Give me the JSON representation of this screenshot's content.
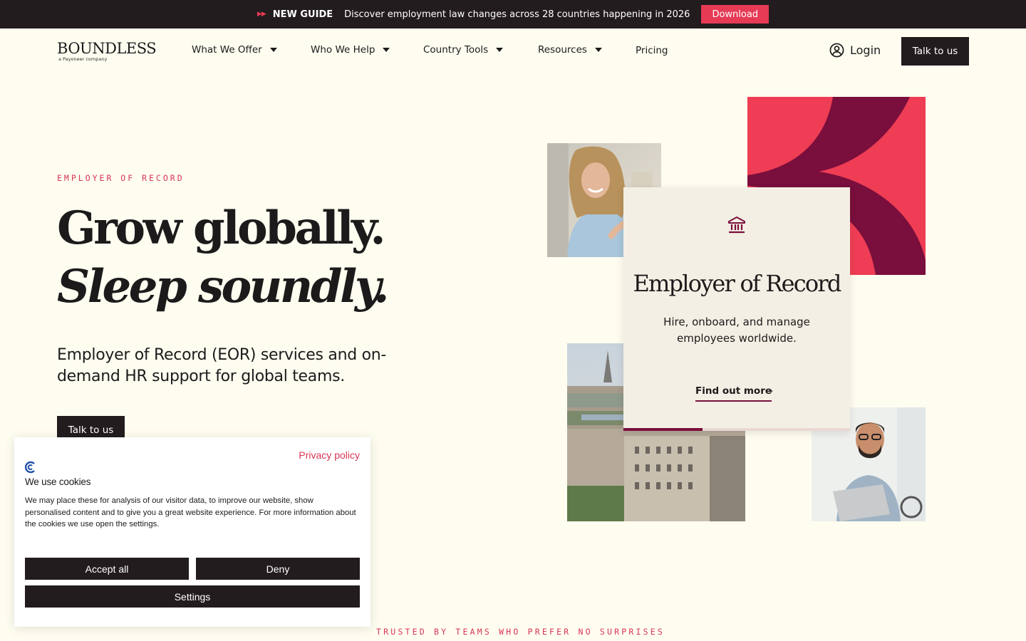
{
  "topbar": {
    "tag": "NEW GUIDE",
    "message": "Discover employment law changes across 28 countries happening in 2026",
    "download_label": "Download"
  },
  "brand": {
    "logo_word": "BOUNDLESS",
    "logo_sub": "a Payoneer company"
  },
  "nav": {
    "items": [
      {
        "label": "What We Offer",
        "dropdown": true
      },
      {
        "label": "Who We Help",
        "dropdown": true
      },
      {
        "label": "Country Tools",
        "dropdown": true
      },
      {
        "label": "Resources",
        "dropdown": true
      },
      {
        "label": "Pricing",
        "dropdown": false
      }
    ],
    "login_label": "Login",
    "login_icon": "user-circle-icon",
    "cta_label": "Talk to us"
  },
  "hero": {
    "eyebrow": "EMPLOYER OF RECORD",
    "headline_line1": "Grow globally.",
    "headline_line2": "Sleep soundly.",
    "lead": "Employer of Record (EOR) services and on-demand HR support for global teams.",
    "cta_label": "Talk to us"
  },
  "feature_card": {
    "icon": "bank-icon",
    "title": "Employer of Record",
    "description": "Hire, onboard, and manage employees worldwide.",
    "link_label": "Find out more",
    "carousel_progress": 0.35
  },
  "cookie": {
    "privacy_link": "Privacy policy",
    "heading": "We use cookies",
    "body": "We may place these for analysis of our visitor data, to improve our website, show personalised content and to give you a great website experience. For more information about the cookies we use open the settings.",
    "accept_label": "Accept all",
    "deny_label": "Deny",
    "settings_label": "Settings"
  },
  "trusted_heading": "TRUSTED BY TEAMS WHO PREFER NO SURPRISES",
  "colors": {
    "background": "#fefdf0",
    "dark": "#221c1e",
    "accent": "#e63a55",
    "maroon": "#7a0e3c"
  }
}
